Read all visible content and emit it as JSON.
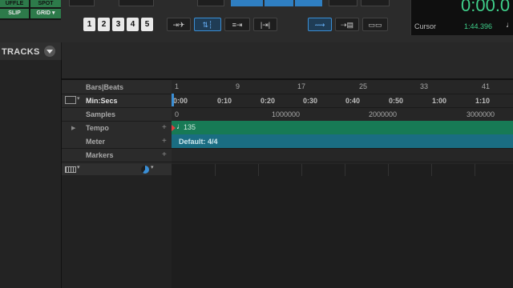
{
  "toolbar": {
    "modes": {
      "shuffle": "UFFLE",
      "spot": "SPOT",
      "slip": "SLIP",
      "grid": "GRID"
    },
    "zoom_presets": [
      "1",
      "2",
      "3",
      "4",
      "5"
    ],
    "cursor_label": "Cursor",
    "cursor_value": "1:44.396",
    "counter_partial": "0:00.0"
  },
  "tracks": {
    "title": "TRACKS"
  },
  "rulers": {
    "labels": {
      "bars_beats": "Bars|Beats",
      "min_secs": "Min:Secs",
      "samples": "Samples",
      "tempo": "Tempo",
      "meter": "Meter",
      "markers": "Markers"
    },
    "bars_ticks": [
      "1",
      "9",
      "17",
      "25",
      "33",
      "41"
    ],
    "minsec_ticks": [
      "0:00",
      "0:10",
      "0:20",
      "0:30",
      "0:40",
      "0:50",
      "1:00",
      "1:10"
    ],
    "sample_ticks": [
      "0",
      "1000000",
      "2000000",
      "3000000"
    ],
    "tempo_value": "135",
    "meter_value": "Default: 4/4"
  },
  "colors": {
    "tempo_lane": "#177a55",
    "meter_lane": "#1a6d82",
    "accent": "#3a8fd6",
    "mode_green": "#2d7a4a"
  }
}
